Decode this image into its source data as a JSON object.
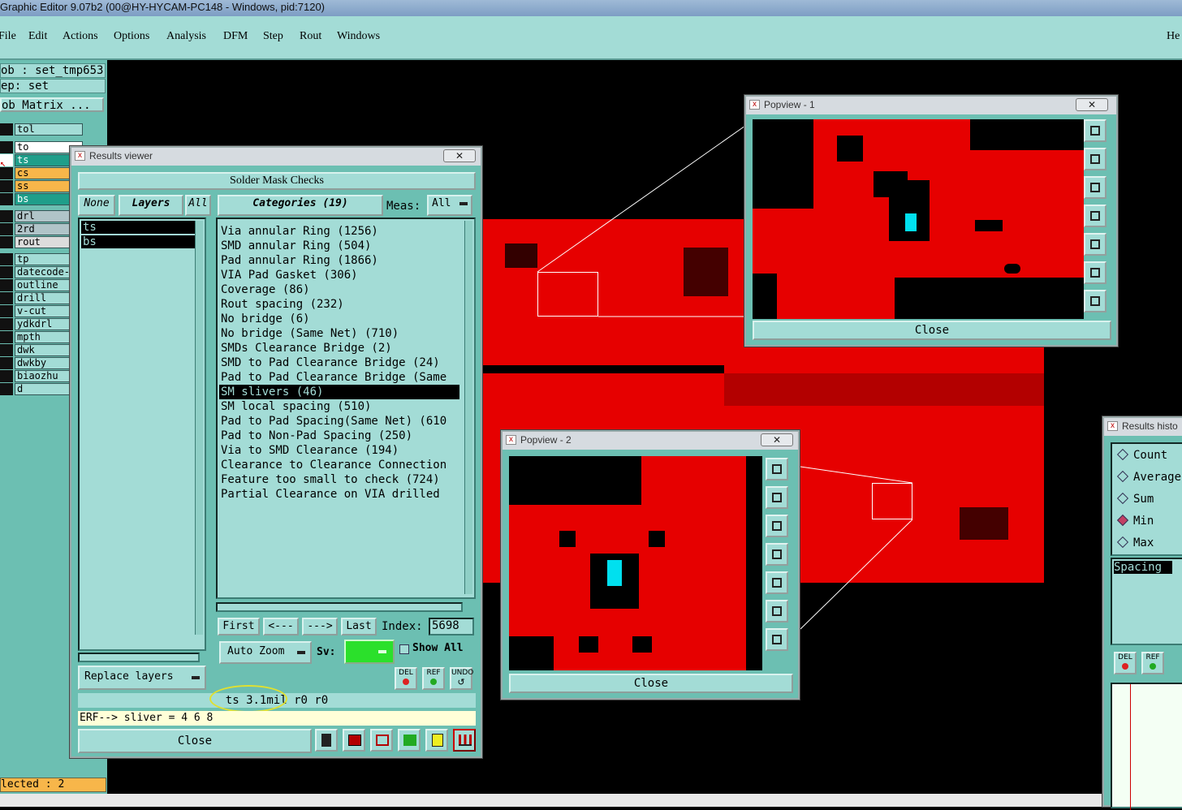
{
  "app": {
    "title": "Graphic Editor 9.07b2 (00@HY-HYCAM-PC148 - Windows, pid:7120)"
  },
  "menu": [
    "File",
    "Edit",
    "Actions",
    "Options",
    "Analysis",
    "DFM",
    "Step",
    "Rout",
    "Windows"
  ],
  "menu_right": "He",
  "job": {
    "job_label": "ob : set_tmp653",
    "step_label": "ep: set",
    "matrix_label": "ob Matrix ..."
  },
  "layers": [
    "tol",
    "to",
    "ts",
    "cs",
    "ss",
    "bs",
    "drl",
    "2rd",
    "rout",
    "tp",
    "datecode-",
    "outline",
    "drill",
    "v-cut",
    "ydkdrl",
    "mpth",
    "dwk",
    "dwkby",
    "biaozhu",
    "d"
  ],
  "selected_status": "lected : 2",
  "results_viewer": {
    "title": "Results viewer",
    "header": "Solder Mask Checks",
    "none_btn": "None",
    "layers_btn": "Layers",
    "all_btn": "All",
    "categories_btn": "Categories (19)",
    "meas_label": "Meas:",
    "meas_value": "All",
    "layer_list": [
      "ts",
      "bs"
    ],
    "categories": [
      "Via annular Ring (1256)",
      "SMD annular Ring (504)",
      "Pad annular Ring (1866)",
      "VIA Pad Gasket (306)",
      "Coverage (86)",
      "Rout spacing (232)",
      "No bridge (6)",
      "No bridge (Same Net) (710)",
      "SMDs Clearance Bridge (2)",
      "SMD to Pad Clearance Bridge (24)",
      "Pad to Pad Clearance Bridge (Same",
      "SM slivers (46)",
      "SM local spacing (510)",
      "Pad to Pad Spacing(Same Net) (610",
      "Pad to Non-Pad Spacing (250)",
      "Via to SMD Clearance (194)",
      "Clearance to Clearance Connection",
      "Feature too small to check (724)",
      "Partial Clearance on VIA drilled"
    ],
    "selected_category": 11,
    "first": "First",
    "prev": "<---",
    "next": "--->",
    "last": "Last",
    "index_label": "Index:",
    "index_value": "5698",
    "zoom": "Auto Zoom",
    "sv_label": "Sv:",
    "show_all": "Show All",
    "replace": "Replace layers",
    "del": "DEL",
    "ref": "REF",
    "undo": "UNDO",
    "status": "ts 3.1mil   r0   r0",
    "erf": "ERF--> sliver = 4 6 8",
    "close": "Close"
  },
  "popview1": {
    "title": "Popview - 1",
    "close": "Close"
  },
  "popview2": {
    "title": "Popview - 2",
    "close": "Close"
  },
  "histogram": {
    "title": "Results histo",
    "options": [
      "Count",
      "Average",
      "Sum",
      "Min",
      "Max"
    ],
    "selected_option": 3,
    "field": "Spacing",
    "del": "DEL",
    "ref": "REF"
  },
  "colors": {
    "board": "#e60000",
    "panel": "#6cbfb2",
    "light": "#a3dcd6",
    "highlight": "#00e0ef"
  }
}
